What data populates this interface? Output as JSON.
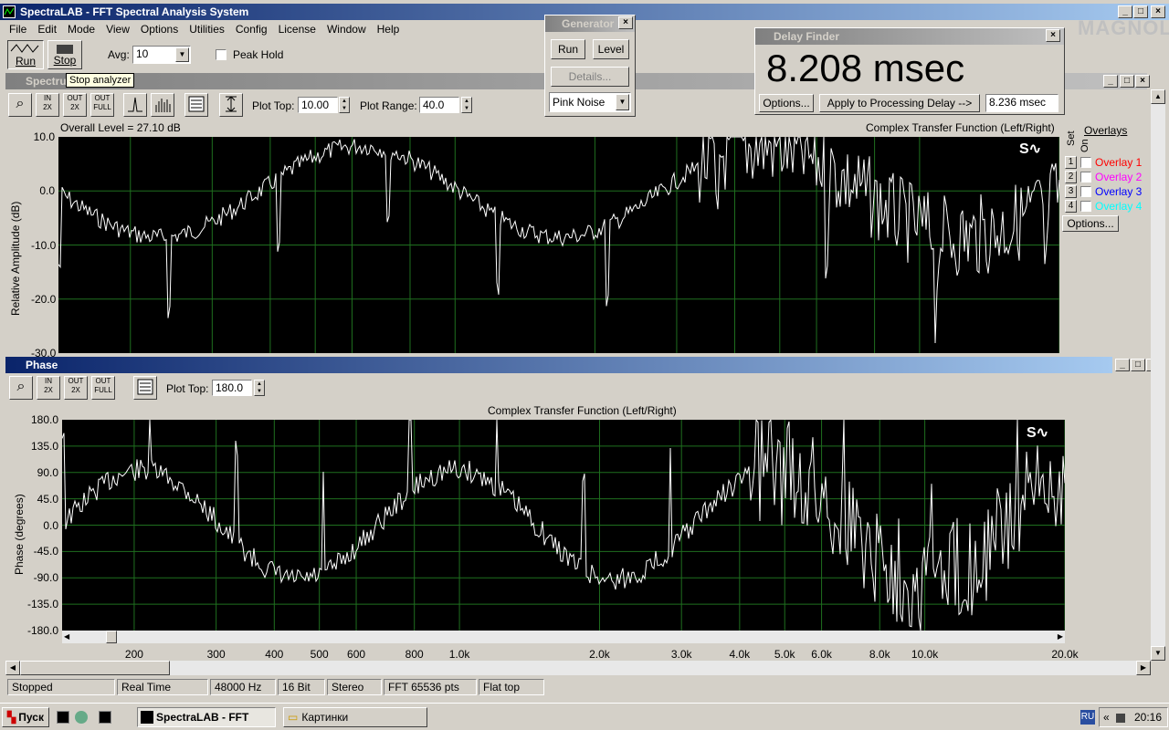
{
  "app": {
    "title": "SpectraLAB - FFT Spectral Analysis System",
    "menu": [
      "File",
      "Edit",
      "Mode",
      "View",
      "Options",
      "Utilities",
      "Config",
      "License",
      "Window",
      "Help"
    ],
    "toolbar": {
      "run_label": "Run",
      "stop_label": "Stop",
      "avg_label": "Avg:",
      "avg_value": "10",
      "peak_hold_label": "Peak Hold",
      "tooltip": "Stop analyzer"
    },
    "logo_text": "MAGNOLA"
  },
  "spectrum": {
    "title": "Spectru",
    "plot_top_label": "Plot Top:",
    "plot_top_value": "10.00",
    "plot_range_label": "Plot Range:",
    "plot_range_value": "40.0",
    "overall_level": "Overall Level = 27.10 dB",
    "plot_title": "Complex Transfer Function (Left/Right)",
    "ylabel": "Relative Amplitude (dB)",
    "yticks": [
      "10.0",
      "0.0",
      "-10.0",
      "-20.0",
      "-30.0"
    ],
    "overlays_title": "Overlays",
    "set_label": "Set",
    "on_label": "On",
    "overlays": [
      {
        "num": "1",
        "label": "Overlay 1",
        "color": "#ff0000"
      },
      {
        "num": "2",
        "label": "Overlay 2",
        "color": "#ff00ff"
      },
      {
        "num": "3",
        "label": "Overlay 3",
        "color": "#0000ff"
      },
      {
        "num": "4",
        "label": "Overlay 4",
        "color": "#00ffff"
      }
    ],
    "options_label": "Options..."
  },
  "phase": {
    "title": "Phase",
    "plot_top_label": "Plot Top:",
    "plot_top_value": "180.0",
    "plot_title": "Complex Transfer Function (Left/Right)",
    "ylabel": "Phase (degrees)",
    "yticks": [
      "180.0",
      "135.0",
      "90.0",
      "45.0",
      "0.0",
      "-45.0",
      "-90.0",
      "-135.0",
      "-180.0"
    ],
    "xticks": [
      "200",
      "300",
      "400",
      "500",
      "600",
      "800",
      "1.0k",
      "2.0k",
      "3.0k",
      "4.0k",
      "5.0k",
      "6.0k",
      "8.0k",
      "10.0k",
      "20.0k"
    ]
  },
  "generator": {
    "title": "Generator",
    "run_label": "Run",
    "level_label": "Level",
    "details_label": "Details...",
    "signal": "Pink Noise"
  },
  "delay_finder": {
    "title": "Delay Finder",
    "value": "8.208 msec",
    "options_label": "Options...",
    "apply_label": "Apply to Processing Delay -->",
    "applied_value": "8.236 msec"
  },
  "status": [
    "Stopped",
    "Real Time",
    "48000 Hz",
    "16 Bit",
    "Stereo",
    "FFT 65536 pts",
    "Flat top"
  ],
  "taskbar": {
    "start_label": "Пуск",
    "task1_label": "SpectraLAB - FFT Spe...",
    "task2_label": "Картинки",
    "lang": "RU",
    "clock": "20:16"
  }
}
